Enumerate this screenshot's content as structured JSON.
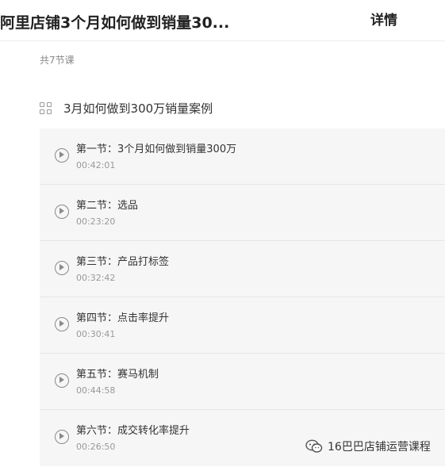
{
  "header": {
    "title": "阿里店铺3个月如何做到销量30...",
    "detail_label": "详情"
  },
  "course": {
    "count_label": "共7节课",
    "chapter_icon": "grid-icon",
    "chapter_title": "3月如何做到300万销量案例",
    "lessons": [
      {
        "title": "第一节：3个月如何做到销量300万",
        "duration": "00:42:01"
      },
      {
        "title": "第二节：选品",
        "duration": "00:23:20"
      },
      {
        "title": "第三节：产品打标签",
        "duration": "00:32:42"
      },
      {
        "title": "第四节：点击率提升",
        "duration": "00:30:41"
      },
      {
        "title": "第五节：赛马机制",
        "duration": "00:44:58"
      },
      {
        "title": "第六节：成交转化率提升",
        "duration": "00:26:50"
      }
    ]
  },
  "watermark": {
    "icon": "wechat-icon",
    "text": "16巴巴店铺运营课程"
  }
}
